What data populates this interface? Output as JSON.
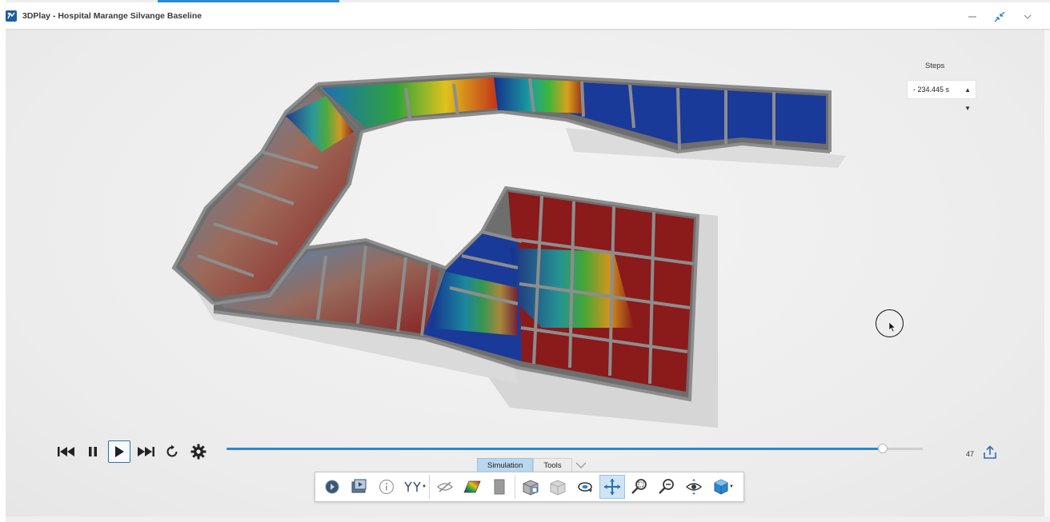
{
  "window": {
    "title": "3DPlay - Hospital Marange Silvange Baseline",
    "controls": [
      "minimize-icon",
      "restore-icon",
      "chevron-down-icon"
    ]
  },
  "steps": {
    "label": "Steps",
    "selected": "- 234.445 s"
  },
  "playback": {
    "buttons": [
      "skip-to-start-icon",
      "pause-icon",
      "play-icon",
      "skip-to-end-icon",
      "reload-icon",
      "gear-icon"
    ],
    "active": "play-icon",
    "timeline_progress": 0.942,
    "frame": "47"
  },
  "tabs": [
    {
      "label": "Simulation",
      "active": true
    },
    {
      "label": "Tools",
      "active": false
    }
  ],
  "toolbar": {
    "icons": [
      "sphere-icon",
      "animation-icon",
      "info-icon",
      "filter-icon",
      "hide-icon",
      "color-map-icon",
      "plane-icon",
      "section-box-icon",
      "ghost-box-icon",
      "rotate-icon",
      "pan-icon",
      "zoom-area-icon",
      "zoom-icon",
      "look-around-icon",
      "view-cube-icon"
    ],
    "active": "pan-icon"
  },
  "colors": {
    "accent": "#2b87cf",
    "wall": "#7a7a7a",
    "hot": "#8b1a1a",
    "cold": "#152f8c",
    "mid": "#2fa33a"
  }
}
